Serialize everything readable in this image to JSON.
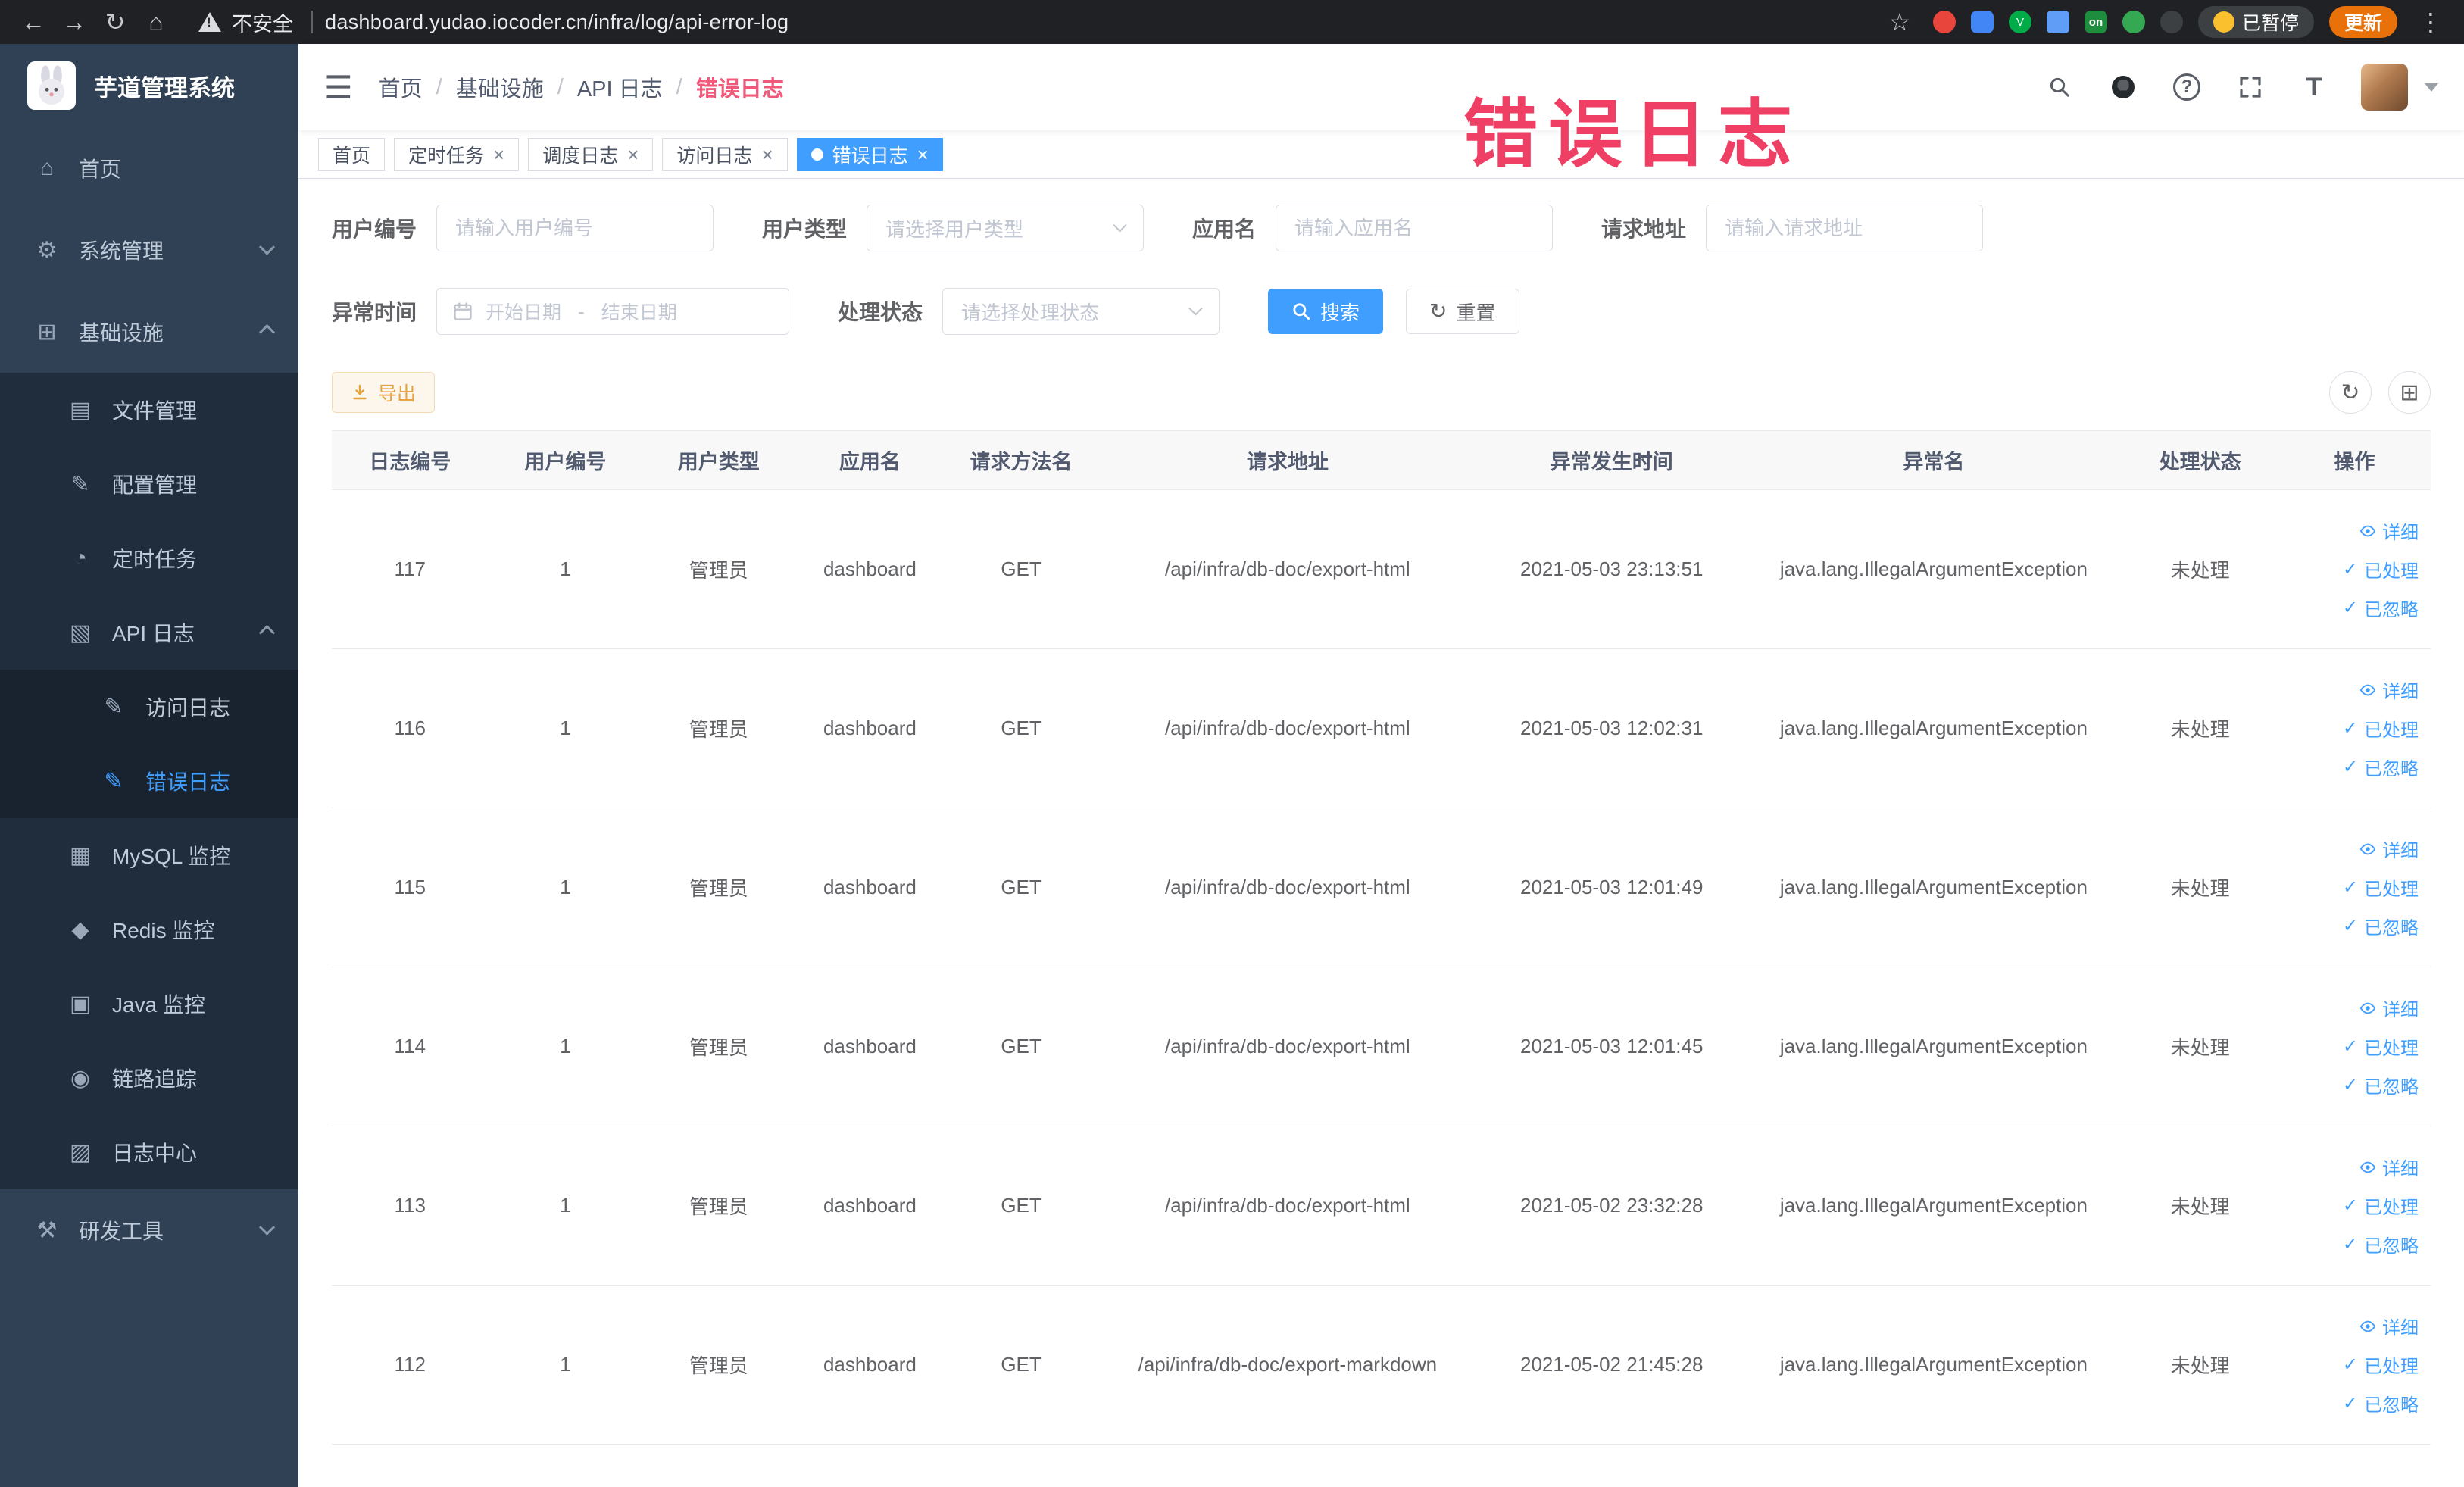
{
  "browser": {
    "security_label": "不安全",
    "url": "dashboard.yudao.iocoder.cn/infra/log/api-error-log",
    "paused_badge": "已暂停",
    "update_button": "更新",
    "extension_on_badge": "on"
  },
  "theme": {
    "accent": "#409eff",
    "sidebar_bg": "#304156",
    "warning": "#e6a23c",
    "annotation_pink": "#ef3f64"
  },
  "icons": {
    "back": "←",
    "forward": "→",
    "reload": "↻",
    "home": "⌂",
    "star": "☆",
    "kebab": "⋮",
    "hamburger": "☰",
    "help": "?",
    "font_size": "T",
    "close": "×",
    "check": "✓",
    "refresh": "↻",
    "columns": "⊞"
  },
  "sidebar": {
    "logo_title": "芋道管理系统",
    "items": [
      {
        "label": "首页",
        "icon": "⌂"
      },
      {
        "label": "系统管理",
        "icon": "⚙"
      },
      {
        "label": "基础设施",
        "icon": "⊞"
      },
      {
        "label": "文件管理",
        "icon": "▤"
      },
      {
        "label": "配置管理",
        "icon": "✎"
      },
      {
        "label": "定时任务",
        "icon": "◔"
      },
      {
        "label": "API 日志",
        "icon": "▧"
      },
      {
        "label": "访问日志",
        "icon": "✎"
      },
      {
        "label": "错误日志",
        "icon": "✎"
      },
      {
        "label": "MySQL 监控",
        "icon": "▦"
      },
      {
        "label": "Redis 监控",
        "icon": "◆"
      },
      {
        "label": "Java 监控",
        "icon": "▣"
      },
      {
        "label": "链路追踪",
        "icon": "◉"
      },
      {
        "label": "日志中心",
        "icon": "▨"
      },
      {
        "label": "研发工具",
        "icon": "⚒"
      }
    ]
  },
  "header": {
    "breadcrumb": [
      "首页",
      "基础设施",
      "API 日志",
      "错误日志"
    ],
    "watermark": "错误日志"
  },
  "tabs": [
    {
      "label": "首页",
      "closable": false,
      "active": false
    },
    {
      "label": "定时任务",
      "closable": true,
      "active": false
    },
    {
      "label": "调度日志",
      "closable": true,
      "active": false
    },
    {
      "label": "访问日志",
      "closable": true,
      "active": false
    },
    {
      "label": "错误日志",
      "closable": true,
      "active": true
    }
  ],
  "filters": {
    "user_id": {
      "label": "用户编号",
      "placeholder": "请输入用户编号"
    },
    "user_type": {
      "label": "用户类型",
      "placeholder": "请选择用户类型"
    },
    "app_name": {
      "label": "应用名",
      "placeholder": "请输入应用名"
    },
    "request_url": {
      "label": "请求地址",
      "placeholder": "请输入请求地址"
    },
    "exception_time": {
      "label": "异常时间",
      "start_placeholder": "开始日期",
      "separator": "-",
      "end_placeholder": "结束日期"
    },
    "process_status": {
      "label": "处理状态",
      "placeholder": "请选择处理状态"
    },
    "search_button": "搜索",
    "reset_button": "重置"
  },
  "toolbar": {
    "export_button": "导出"
  },
  "table": {
    "columns": [
      "日志编号",
      "用户编号",
      "用户类型",
      "应用名",
      "请求方法名",
      "请求地址",
      "异常发生时间",
      "异常名",
      "处理状态",
      "操作"
    ],
    "row_actions": [
      "详细",
      "已处理",
      "已忽略"
    ],
    "rows": [
      {
        "id": "117",
        "user_id": "1",
        "user_type": "管理员",
        "app": "dashboard",
        "method": "GET",
        "url": "/api/infra/db-doc/export-html",
        "time": "2021-05-03 23:13:51",
        "exception": "java.lang.IllegalArgumentException",
        "status": "未处理"
      },
      {
        "id": "116",
        "user_id": "1",
        "user_type": "管理员",
        "app": "dashboard",
        "method": "GET",
        "url": "/api/infra/db-doc/export-html",
        "time": "2021-05-03 12:02:31",
        "exception": "java.lang.IllegalArgumentException",
        "status": "未处理"
      },
      {
        "id": "115",
        "user_id": "1",
        "user_type": "管理员",
        "app": "dashboard",
        "method": "GET",
        "url": "/api/infra/db-doc/export-html",
        "time": "2021-05-03 12:01:49",
        "exception": "java.lang.IllegalArgumentException",
        "status": "未处理"
      },
      {
        "id": "114",
        "user_id": "1",
        "user_type": "管理员",
        "app": "dashboard",
        "method": "GET",
        "url": "/api/infra/db-doc/export-html",
        "time": "2021-05-03 12:01:45",
        "exception": "java.lang.IllegalArgumentException",
        "status": "未处理"
      },
      {
        "id": "113",
        "user_id": "1",
        "user_type": "管理员",
        "app": "dashboard",
        "method": "GET",
        "url": "/api/infra/db-doc/export-html",
        "time": "2021-05-02 23:32:28",
        "exception": "java.lang.IllegalArgumentException",
        "status": "未处理"
      },
      {
        "id": "112",
        "user_id": "1",
        "user_type": "管理员",
        "app": "dashboard",
        "method": "GET",
        "url": "/api/infra/db-doc/export-markdown",
        "time": "2021-05-02 21:45:28",
        "exception": "java.lang.IllegalArgumentException",
        "status": "未处理"
      }
    ]
  }
}
